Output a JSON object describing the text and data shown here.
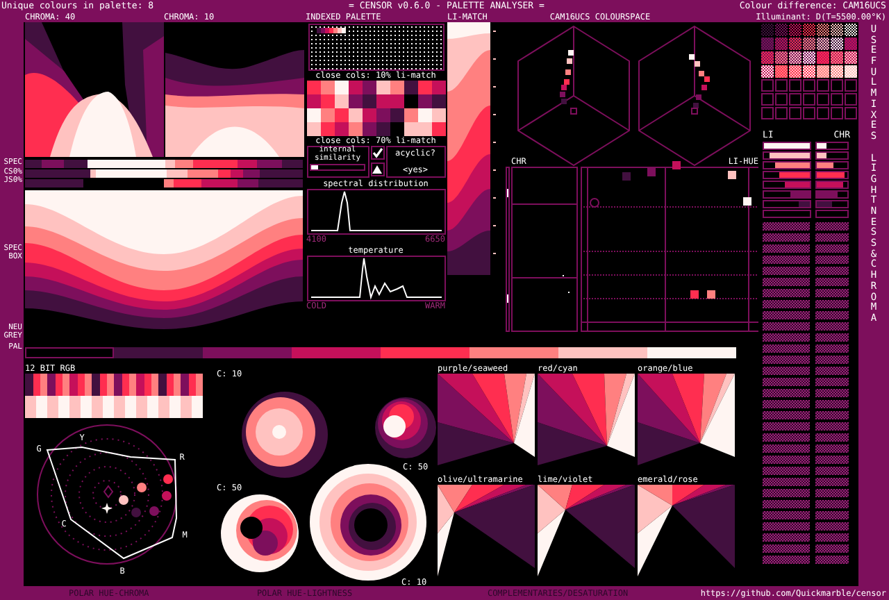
{
  "top_bar": {
    "palette_count": "Unique colours in palette: 8",
    "title": "= CENSOR v0.6.0 - PALETTE ANALYSER =",
    "colour_difference": "Colour difference: CAM16UCS",
    "illuminant": "Illuminant: D(T=5500.00°K)"
  },
  "panel_titles": {
    "chroma_40": "CHROMA: 40",
    "chroma_10": "CHROMA: 10",
    "indexed_palette": "INDEXED PALETTE",
    "li_match": "LI-MATCH",
    "colourspace": "CAM16UCS COLOURSPACE"
  },
  "side_labels": {
    "spec": "SPEC",
    "cs0": "CS0%",
    "js0": "JS0%",
    "spec_box": "SPEC BOX",
    "neu_grey": "NEU GREY",
    "pal": "PAL"
  },
  "palette": [
    {
      "color": "#000000"
    },
    {
      "color": "#42103f"
    },
    {
      "color": "#7d0f5c"
    },
    {
      "color": "#c5105a"
    },
    {
      "color": "#ff2e50"
    },
    {
      "color": "#ff8080"
    },
    {
      "color": "#ffc2c0"
    },
    {
      "color": "#fff5f2"
    }
  ],
  "close_cols": [
    "close cols: 10% li-match",
    "close cols: 70% li-match"
  ],
  "internal_similarity": {
    "label": "internal similarity",
    "level": 0.12
  },
  "checkbox": {
    "checked": true
  },
  "acyclic": {
    "label": "acyclic?",
    "value": "<yes>"
  },
  "spectral": {
    "title": "spectral distribution",
    "min": "4100",
    "max": "6650"
  },
  "temperature": {
    "title": "temperature",
    "min": "COLD",
    "max": "WARM"
  },
  "scatter": {
    "chr_label": "CHR",
    "li_hue_label": "LI-HUE"
  },
  "lightness": {
    "li_label": "LI",
    "chr_label": "CHR",
    "li_bars": [
      {
        "level": 1.0
      },
      {
        "level": 0.89
      },
      {
        "level": 0.76
      },
      {
        "level": 0.66
      },
      {
        "level": 0.55
      },
      {
        "level": 0.41
      },
      {
        "level": 0.23
      },
      {
        "level": 0.0
      }
    ],
    "chr_bars": [
      {
        "level": 0.3
      },
      {
        "level": 0.3
      },
      {
        "level": 0.55
      },
      {
        "level": 0.9
      },
      {
        "level": 0.85
      },
      {
        "level": 0.7
      },
      {
        "level": 0.5
      },
      {
        "level": 0.0
      }
    ]
  },
  "vertical_labels": [
    "USEFUL MIXES",
    "LIGHTNESS & CHROMA"
  ],
  "rgb_label": "12 BIT RGB",
  "polar_labels": [
    "G",
    "Y",
    "R",
    "M",
    "B",
    "C"
  ],
  "circle_labels": [
    "C: 10",
    "C: 50",
    "C: 50",
    "C: 10"
  ],
  "complementaries": [
    "purple/seaweed",
    "red/cyan",
    "orange/blue",
    "olive/ultramarine",
    "lime/violet",
    "emerald/rose"
  ],
  "bottom_bar": {
    "polar_hue_chroma": "POLAR HUE-CHROMA",
    "polar_hue_lightness": "POLAR HUE-LIGHTNESS",
    "complementaries": "COMPLEMENTARIES/DESATURATION",
    "url": "https://github.com/Quickmarble/censor"
  }
}
